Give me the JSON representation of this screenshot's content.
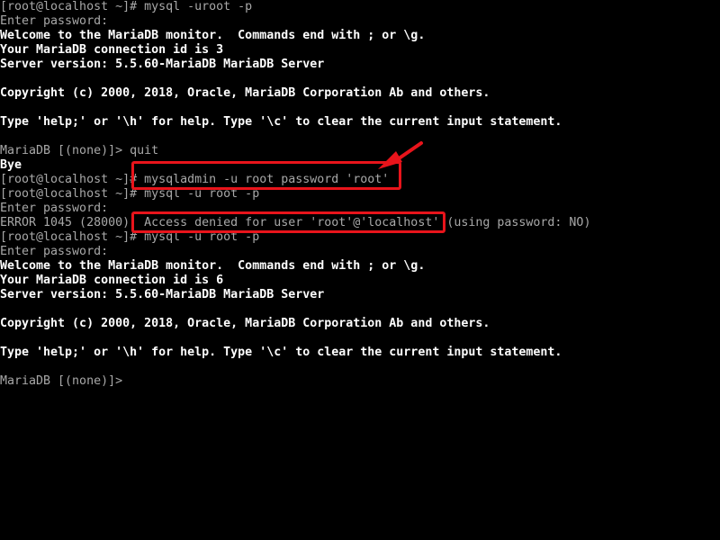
{
  "terminal": {
    "lines": [
      {
        "text": "[root@localhost ~]# mysql -uroot -p",
        "style": "g"
      },
      {
        "text": "Enter password:",
        "style": "g"
      },
      {
        "text": "Welcome to the MariaDB monitor.  Commands end with ; or \\g.",
        "style": "w"
      },
      {
        "text": "Your MariaDB connection id is 3",
        "style": "w"
      },
      {
        "text": "Server version: 5.5.60-MariaDB MariaDB Server",
        "style": "w"
      },
      {
        "text": "",
        "style": "w"
      },
      {
        "text": "Copyright (c) 2000, 2018, Oracle, MariaDB Corporation Ab and others.",
        "style": "w"
      },
      {
        "text": "",
        "style": "w"
      },
      {
        "text": "Type 'help;' or '\\h' for help. Type '\\c' to clear the current input statement.",
        "style": "w"
      },
      {
        "text": "",
        "style": "w"
      },
      {
        "text": "MariaDB [(none)]> quit",
        "style": "g"
      },
      {
        "text": "Bye",
        "style": "w"
      },
      {
        "text": "[root@localhost ~]# mysqladmin -u root password 'root'",
        "style": "g"
      },
      {
        "text": "[root@localhost ~]# mysql -u root -p",
        "style": "g"
      },
      {
        "text": "Enter password:",
        "style": "g"
      },
      {
        "text": "ERROR 1045 (28000): Access denied for user 'root'@'localhost' (using password: NO)",
        "style": "g"
      },
      {
        "text": "[root@localhost ~]# mysql -u root -p",
        "style": "g"
      },
      {
        "text": "Enter password:",
        "style": "g"
      },
      {
        "text": "Welcome to the MariaDB monitor.  Commands end with ; or \\g.",
        "style": "w"
      },
      {
        "text": "Your MariaDB connection id is 6",
        "style": "w"
      },
      {
        "text": "Server version: 5.5.60-MariaDB MariaDB Server",
        "style": "w"
      },
      {
        "text": "",
        "style": "w"
      },
      {
        "text": "Copyright (c) 2000, 2018, Oracle, MariaDB Corporation Ab and others.",
        "style": "w"
      },
      {
        "text": "",
        "style": "w"
      },
      {
        "text": "Type 'help;' or '\\h' for help. Type '\\c' to clear the current input statement.",
        "style": "w"
      },
      {
        "text": "",
        "style": "w"
      },
      {
        "text": "MariaDB [(none)]>",
        "style": "g"
      }
    ]
  },
  "annotations": {
    "color": "#e8141b",
    "arrow": "arrow-icon"
  }
}
